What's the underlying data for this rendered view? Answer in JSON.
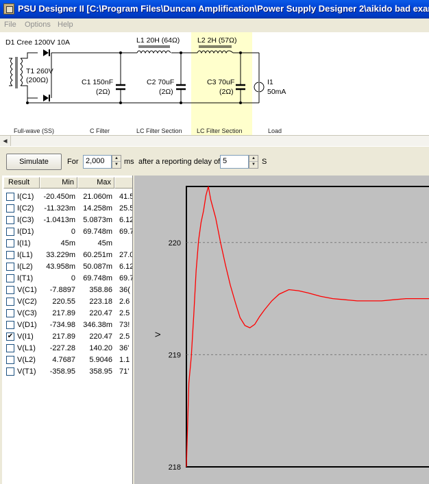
{
  "window": {
    "title": "PSU Designer II  [C:\\Program Files\\Duncan Amplification\\Power Supply Designer 2\\aikido bad exar"
  },
  "menu": {
    "items": [
      "File",
      "Options",
      "Help"
    ]
  },
  "schematic": {
    "diode_label": "D1 Cree 1200V 10A",
    "transformer_label": "T1 260V",
    "transformer_resistance": "(200Ω)",
    "c1_label": "C1 150nF",
    "c1_esr": "(2Ω)",
    "l1_label": "L1 20H (64Ω)",
    "c2_label": "C2 70uF",
    "c2_esr": "(2Ω)",
    "l2_label": "L2 2H (57Ω)",
    "c3_label": "C3 70uF",
    "c3_esr": "(2Ω)",
    "load_label": "I1",
    "load_value": "50mA",
    "sections": [
      "Full-wave (SS)",
      "C Filter",
      "LC Filter Section",
      "LC Filter Section",
      "Load"
    ]
  },
  "toolbar": {
    "simulate_label": "Simulate",
    "for_label": "For",
    "duration_value": "2,000",
    "duration_unit": "ms",
    "delay_label": "after a reporting delay of",
    "delay_value": "5",
    "delay_unit": "S"
  },
  "results": {
    "columns": [
      "Result",
      "Min",
      "Max"
    ],
    "rows": [
      {
        "name": "I(C1)",
        "min": "-20.450m",
        "max": "21.060m",
        "extra": "41.5",
        "checked": false
      },
      {
        "name": "I(C2)",
        "min": "-11.323m",
        "max": "14.258m",
        "extra": "25.5",
        "checked": false
      },
      {
        "name": "I(C3)",
        "min": "-1.0413m",
        "max": "5.0873m",
        "extra": "6.12",
        "checked": false
      },
      {
        "name": "I(D1)",
        "min": "0",
        "max": "69.748m",
        "extra": "69.7",
        "checked": false
      },
      {
        "name": "I(I1)",
        "min": "45m",
        "max": "45m",
        "extra": "",
        "checked": false
      },
      {
        "name": "I(L1)",
        "min": "33.229m",
        "max": "60.251m",
        "extra": "27.0",
        "checked": false
      },
      {
        "name": "I(L2)",
        "min": "43.958m",
        "max": "50.087m",
        "extra": "6.12",
        "checked": false
      },
      {
        "name": "I(T1)",
        "min": "0",
        "max": "69.748m",
        "extra": "69.7",
        "checked": false
      },
      {
        "name": "V(C1)",
        "min": "-7.8897",
        "max": "358.86",
        "extra": "36(",
        "checked": false
      },
      {
        "name": "V(C2)",
        "min": "220.55",
        "max": "223.18",
        "extra": "2.6",
        "checked": false
      },
      {
        "name": "V(C3)",
        "min": "217.89",
        "max": "220.47",
        "extra": "2.5",
        "checked": false
      },
      {
        "name": "V(D1)",
        "min": "-734.98",
        "max": "346.38m",
        "extra": "73!",
        "checked": false
      },
      {
        "name": "V(I1)",
        "min": "217.89",
        "max": "220.47",
        "extra": "2.5",
        "checked": true
      },
      {
        "name": "V(L1)",
        "min": "-227.28",
        "max": "140.20",
        "extra": "36'",
        "checked": false
      },
      {
        "name": "V(L2)",
        "min": "4.7687",
        "max": "5.9046",
        "extra": "1.1",
        "checked": false
      },
      {
        "name": "V(T1)",
        "min": "-358.95",
        "max": "358.95",
        "extra": "71'",
        "checked": false
      }
    ]
  },
  "chart_data": {
    "type": "line",
    "ylabel": "V",
    "ylim": [
      218,
      220.5
    ],
    "yticks": [
      "220",
      "219",
      "218"
    ],
    "grid": true,
    "series_color": "#ff0000",
    "series": [
      {
        "x": [
          0,
          0.01,
          0.02,
          0.03,
          0.04,
          0.05,
          0.06,
          0.07,
          0.08,
          0.09,
          0.1,
          0.12,
          0.14,
          0.16,
          0.18,
          0.2,
          0.22,
          0.24,
          0.26,
          0.28,
          0.3,
          0.32,
          0.35,
          0.38,
          0.42,
          0.46,
          0.5,
          0.55,
          0.6,
          0.65,
          0.7,
          0.75,
          0.8,
          0.85,
          0.9,
          0.95,
          1.0
        ],
        "y": [
          218.0,
          218.75,
          218.98,
          219.35,
          219.75,
          220.02,
          220.18,
          220.28,
          220.42,
          220.5,
          220.38,
          220.22,
          220.0,
          219.8,
          219.62,
          219.47,
          219.33,
          219.26,
          219.24,
          219.27,
          219.34,
          219.4,
          219.48,
          219.54,
          219.58,
          219.57,
          219.55,
          219.52,
          219.5,
          219.49,
          219.48,
          219.48,
          219.48,
          219.49,
          219.5,
          219.5,
          219.5
        ]
      }
    ]
  }
}
